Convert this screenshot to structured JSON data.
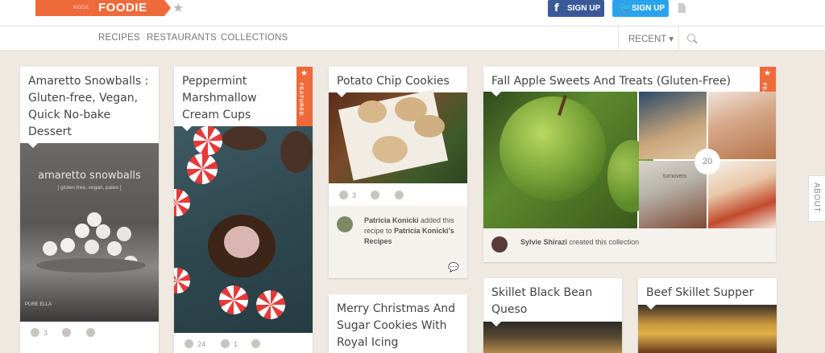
{
  "header": {
    "logo_mode": "MODE",
    "logo_name": "FOODIE",
    "fb_label": "SIGN UP",
    "tw_label": "SIGN UP"
  },
  "nav": {
    "recipes": "RECIPES",
    "restaurants": "RESTAURANTS",
    "collections": "COLLECTIONS",
    "recent": "RECENT ▾"
  },
  "cards": {
    "amaretto": {
      "title": "Amaretto Snowballs : Gluten-free, Vegan, Quick No-bake Dessert",
      "img_title": "amaretto snowballs",
      "img_sub": "[ gluten-free, vegan, paleo ]",
      "watermark": "PURE ELLA",
      "adds": "3"
    },
    "peppermint": {
      "title": "Peppermint Marshmallow Cream Cups",
      "featured": "FEATURED",
      "adds": "24",
      "likes": "1"
    },
    "potato": {
      "title": "Potato Chip Cookies",
      "adds": "3",
      "activity_user": "Patricia Konicki",
      "activity_text": " added this recipe to ",
      "activity_target": "Patricia Konicki's Recipes"
    },
    "fall": {
      "title": "Fall Apple Sweets And Treats (Gluten-Free)",
      "featured": "FEATURED",
      "count": "20",
      "img_caption": "turnovers",
      "activity_user": "Sylvie Shirazi",
      "activity_text": " created this collection"
    },
    "christmas": {
      "title": "Merry Christmas And Sugar Cookies With Royal Icing"
    },
    "skillet_bean": {
      "title": "Skillet Black Bean Queso"
    },
    "beef": {
      "title": "Beef Skillet Supper"
    }
  },
  "about": "ABOUT",
  "colors": {
    "brand": "#ef6a3a",
    "facebook": "#3b5998",
    "twitter": "#2aa3ef",
    "background": "#efe9e2"
  }
}
